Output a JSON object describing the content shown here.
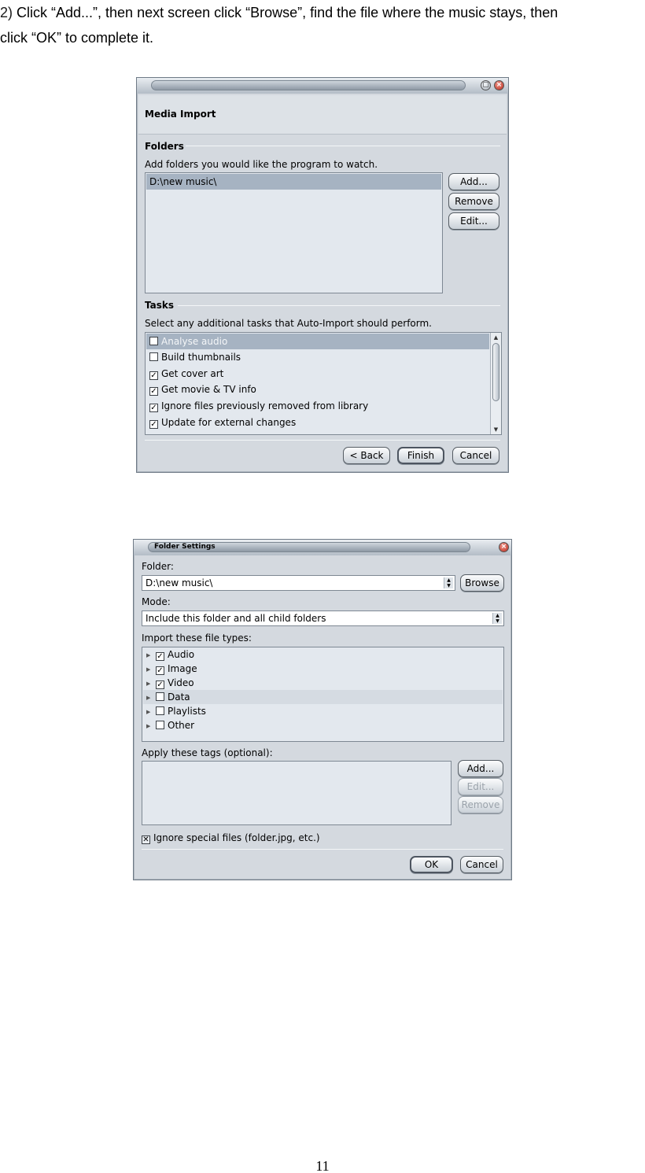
{
  "instruction": {
    "number": "2)",
    "line1": " Click “Add...”, then next screen click “Browse”, find the file where the music stays, then",
    "line2": "click “OK” to complete it."
  },
  "media_import": {
    "heading": "Media Import",
    "folders_section": "Folders",
    "folders_prompt": "Add folders you would like the program to watch.",
    "folder_items": [
      "D:\\new music\\"
    ],
    "add_label": "Add...",
    "remove_label": "Remove",
    "edit_label": "Edit...",
    "tasks_section": "Tasks",
    "tasks_prompt": "Select any additional tasks that Auto-Import should perform.",
    "tasks": [
      {
        "label": "Analyse audio",
        "checked": false
      },
      {
        "label": "Build thumbnails",
        "checked": false
      },
      {
        "label": "Get cover art",
        "checked": true
      },
      {
        "label": "Get movie & TV info",
        "checked": true
      },
      {
        "label": "Ignore files previously removed from library",
        "checked": true
      },
      {
        "label": "Update for external changes",
        "checked": true
      }
    ],
    "back_label": "< Back",
    "finish_label": "Finish",
    "cancel_label": "Cancel"
  },
  "folder_settings": {
    "title": "Folder Settings",
    "folder_label": "Folder:",
    "folder_value": "D:\\new music\\",
    "browse_label": "Browse",
    "mode_label": "Mode:",
    "mode_value": "Include this folder and all child folders",
    "import_label": "Import these file types:",
    "file_types": [
      {
        "label": "Audio",
        "checked": true
      },
      {
        "label": "Image",
        "checked": true
      },
      {
        "label": "Video",
        "checked": true
      },
      {
        "label": "Data",
        "checked": false
      },
      {
        "label": "Playlists",
        "checked": false
      },
      {
        "label": "Other",
        "checked": false
      }
    ],
    "tags_label": "Apply these tags (optional):",
    "add_label": "Add...",
    "edit_label": "Edit...",
    "remove_label": "Remove",
    "ignore_label": "Ignore special files (folder.jpg, etc.)",
    "ignore_checked": true,
    "ok_label": "OK",
    "cancel_label": "Cancel"
  },
  "page_number": "11"
}
